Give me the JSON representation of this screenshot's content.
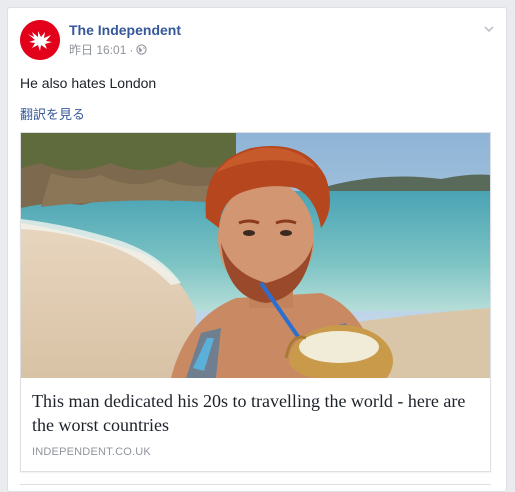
{
  "post": {
    "page_name": "The Independent",
    "timestamp": "昨日 16:01",
    "separator": "·",
    "privacy_icon": "globe-icon",
    "text": "He also hates London",
    "see_translation": "翻訳を見る",
    "options_icon": "chevron-down-icon"
  },
  "link_preview": {
    "image_alt": "man with red hair drinking from a coconut on a tropical beach",
    "title": "This man dedicated his 20s to travelling the world - here are the worst countries",
    "domain": "INDEPENDENT.CO.UK"
  },
  "colors": {
    "brand_red": "#e2001a",
    "link_blue": "#365899",
    "muted_gray": "#90949c",
    "background": "#e9ebee"
  }
}
